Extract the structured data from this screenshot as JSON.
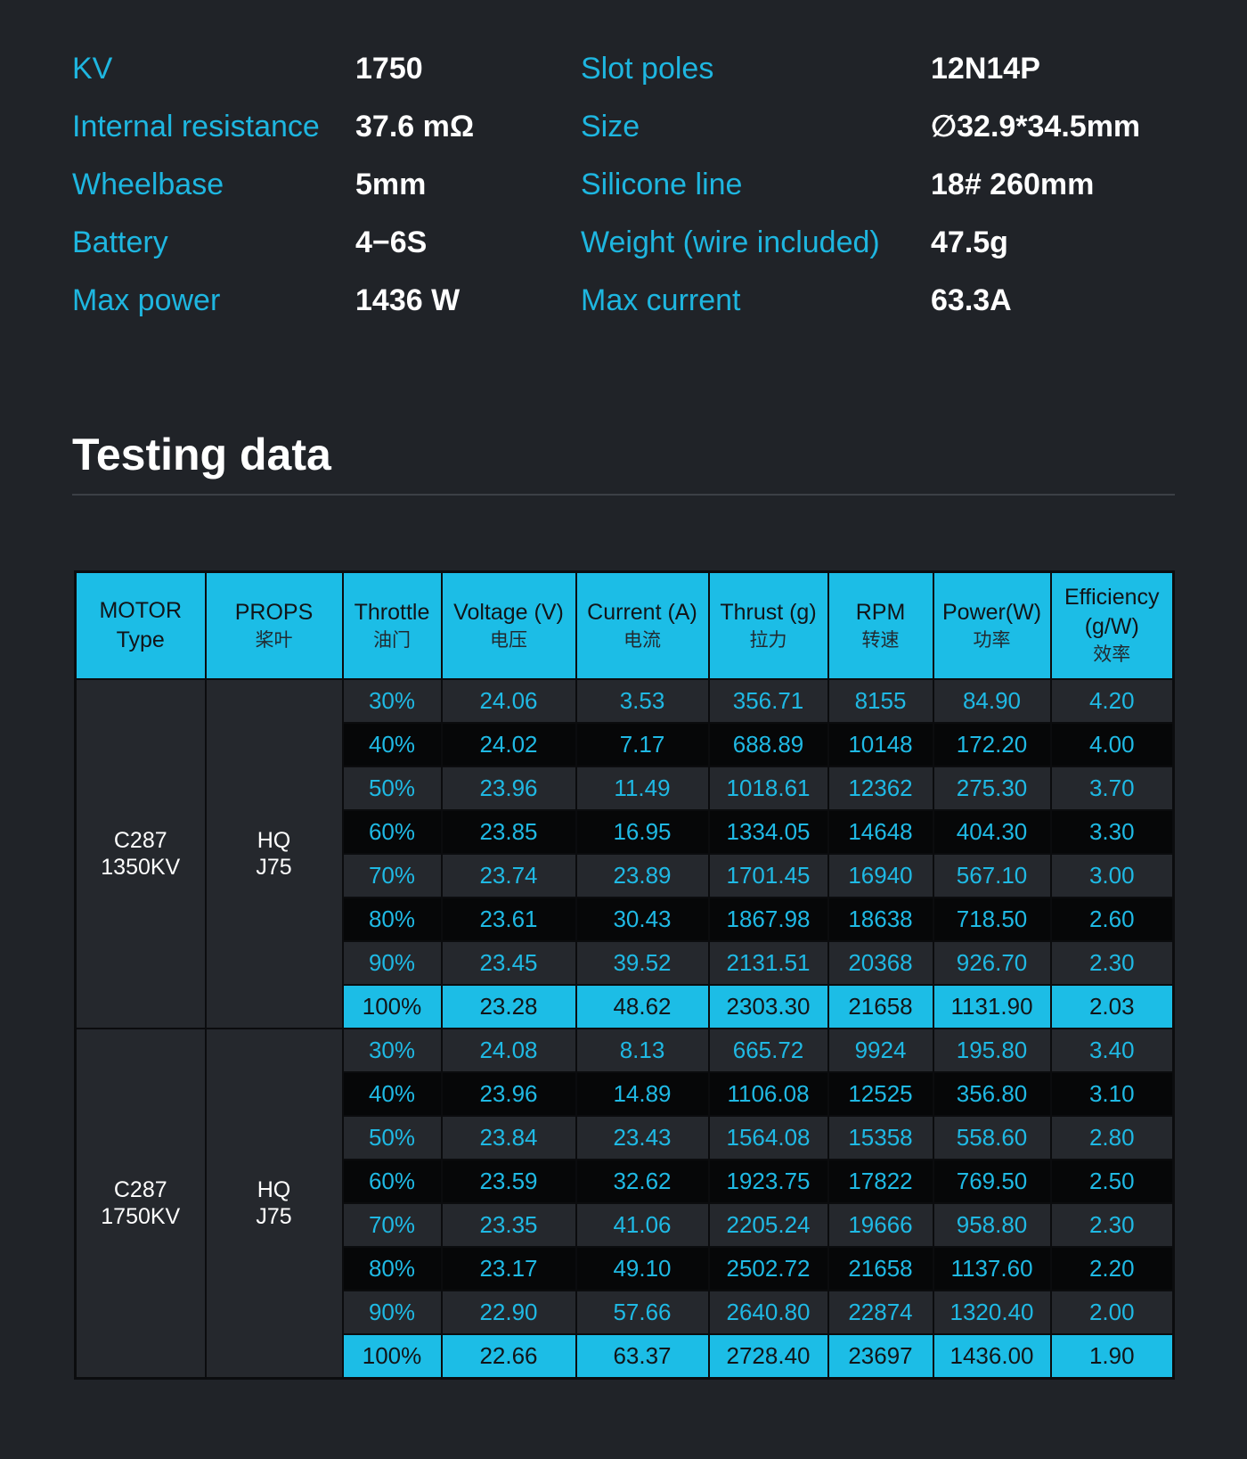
{
  "specs": [
    {
      "label1": "KV",
      "value1": "1750",
      "label2": "Slot poles",
      "value2": "12N14P"
    },
    {
      "label1": "Internal resistance",
      "value1": "37.6 mΩ",
      "label2": "Size",
      "value2": "∅32.9*34.5mm"
    },
    {
      "label1": "Wheelbase",
      "value1": "5mm",
      "label2": "Silicone line",
      "value2": "18# 260mm"
    },
    {
      "label1": "Battery",
      "value1": "4−6S",
      "label2": "Weight (wire included)",
      "value2": "47.5g"
    },
    {
      "label1": "Max power",
      "value1": "1436 W",
      "label2": "Max current",
      "value2": "63.3A"
    }
  ],
  "section_title": "Testing data",
  "colors": {
    "background": "#202328",
    "accent": "#1cbde6",
    "label_text": "#1eb6e0",
    "row_dark": "#060708",
    "row_light": "#25282d"
  },
  "table": {
    "headers": [
      {
        "en": "MOTOR",
        "en2": "Type",
        "zh": ""
      },
      {
        "en": "PROPS",
        "en2": "",
        "zh": "桨叶"
      },
      {
        "en": "Throttle",
        "en2": "",
        "zh": "油门"
      },
      {
        "en": "Voltage (V)",
        "en2": "",
        "zh": "电压"
      },
      {
        "en": "Current (A)",
        "en2": "",
        "zh": "电流"
      },
      {
        "en": "Thrust (g)",
        "en2": "",
        "zh": "拉力"
      },
      {
        "en": "RPM",
        "en2": "",
        "zh": "转速"
      },
      {
        "en": "Power(W)",
        "en2": "",
        "zh": "功率"
      },
      {
        "en": "Efficiency",
        "en2": "(g/W)",
        "zh": "效率"
      }
    ],
    "groups": [
      {
        "motor": [
          "C287",
          "1350KV"
        ],
        "props": [
          "HQ",
          "J75"
        ],
        "rows": [
          [
            "30%",
            "24.06",
            "3.53",
            "356.71",
            "8155",
            "84.90",
            "4.20"
          ],
          [
            "40%",
            "24.02",
            "7.17",
            "688.89",
            "10148",
            "172.20",
            "4.00"
          ],
          [
            "50%",
            "23.96",
            "11.49",
            "1018.61",
            "12362",
            "275.30",
            "3.70"
          ],
          [
            "60%",
            "23.85",
            "16.95",
            "1334.05",
            "14648",
            "404.30",
            "3.30"
          ],
          [
            "70%",
            "23.74",
            "23.89",
            "1701.45",
            "16940",
            "567.10",
            "3.00"
          ],
          [
            "80%",
            "23.61",
            "30.43",
            "1867.98",
            "18638",
            "718.50",
            "2.60"
          ],
          [
            "90%",
            "23.45",
            "39.52",
            "2131.51",
            "20368",
            "926.70",
            "2.30"
          ],
          [
            "100%",
            "23.28",
            "48.62",
            "2303.30",
            "21658",
            "1131.90",
            "2.03"
          ]
        ]
      },
      {
        "motor": [
          "C287",
          "1750KV"
        ],
        "props": [
          "HQ",
          "J75"
        ],
        "rows": [
          [
            "30%",
            "24.08",
            "8.13",
            "665.72",
            "9924",
            "195.80",
            "3.40"
          ],
          [
            "40%",
            "23.96",
            "14.89",
            "1106.08",
            "12525",
            "356.80",
            "3.10"
          ],
          [
            "50%",
            "23.84",
            "23.43",
            "1564.08",
            "15358",
            "558.60",
            "2.80"
          ],
          [
            "60%",
            "23.59",
            "32.62",
            "1923.75",
            "17822",
            "769.50",
            "2.50"
          ],
          [
            "70%",
            "23.35",
            "41.06",
            "2205.24",
            "19666",
            "958.80",
            "2.30"
          ],
          [
            "80%",
            "23.17",
            "49.10",
            "2502.72",
            "21658",
            "1137.60",
            "2.20"
          ],
          [
            "90%",
            "22.90",
            "57.66",
            "2640.80",
            "22874",
            "1320.40",
            "2.00"
          ],
          [
            "100%",
            "22.66",
            "63.37",
            "2728.40",
            "23697",
            "1436.00",
            "1.90"
          ]
        ]
      }
    ]
  }
}
